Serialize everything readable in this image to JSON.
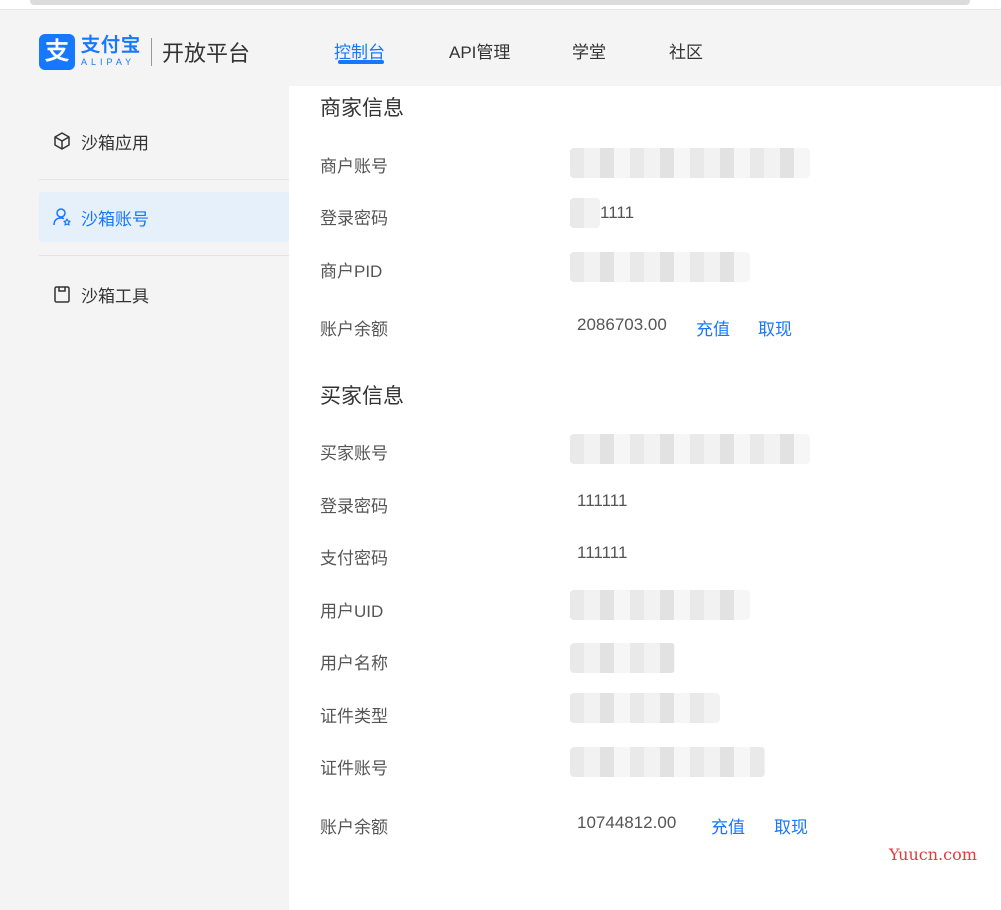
{
  "brand": {
    "mark": "支",
    "name_cn": "支付宝",
    "name_en": "ALIPAY",
    "platform": "开放平台",
    "accent": "#1677ff"
  },
  "nav": {
    "items": [
      {
        "label": "控制台",
        "active": true
      },
      {
        "label": "API管理",
        "active": false
      },
      {
        "label": "学堂",
        "active": false
      },
      {
        "label": "社区",
        "active": false
      }
    ]
  },
  "sidebar": {
    "items": [
      {
        "label": "沙箱应用",
        "icon": "cube-icon",
        "active": false
      },
      {
        "label": "沙箱账号",
        "icon": "user-icon",
        "active": true
      },
      {
        "label": "沙箱工具",
        "icon": "clipboard-icon",
        "active": false
      }
    ]
  },
  "merchant": {
    "title": "商家信息",
    "account_label": "商户账号",
    "password_label": "登录密码",
    "password_value": "1111",
    "pid_label": "商户PID",
    "balance_label": "账户余额",
    "balance_value": "2086703.00",
    "recharge": "充值",
    "withdraw": "取现"
  },
  "buyer": {
    "title": "买家信息",
    "account_label": "买家账号",
    "login_password_label": "登录密码",
    "login_password_value": "111111",
    "pay_password_label": "支付密码",
    "pay_password_value": "111111",
    "uid_label": "用户UID",
    "name_label": "用户名称",
    "id_type_label": "证件类型",
    "id_number_label": "证件账号",
    "balance_label": "账户余额",
    "balance_value": "10744812.00",
    "recharge": "充值",
    "withdraw": "取现"
  },
  "watermark": "Yuucn.com"
}
